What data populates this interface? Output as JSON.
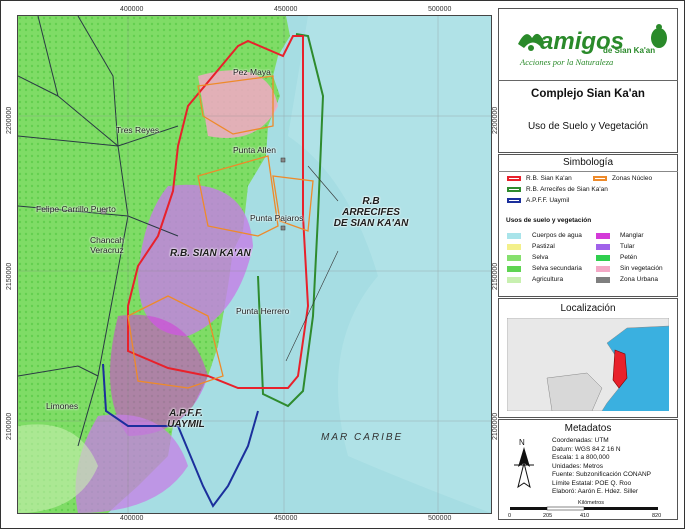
{
  "map": {
    "x_ticks": [
      "400000",
      "450000",
      "500000"
    ],
    "y_ticks": [
      "2200000",
      "2150000",
      "2100000"
    ],
    "places": {
      "pez_maya": "Pez Maya",
      "tres_reyes": "Tres Reyes",
      "punta_allen": "Punta Allen",
      "felipe_carrillo": "Felipe Carrillo Puerto",
      "punta_pajaros": "Punta Pajaros",
      "chancah": "Chancah\nVeracruz",
      "punta_herrero": "Punta Herrero",
      "limones": "Limones"
    },
    "area_labels": {
      "rb_sian_kaan": "R.B. SIAN KA'AN",
      "rb_arrecifes": "R.B\nARRECIFES\nDE SIAN KA'AN",
      "apff_uaymil": "A.P.F.F.\nUAYMIL"
    },
    "sea_label": "MAR CARIBE"
  },
  "header": {
    "brand": "amigos",
    "brand_sub": "de Sian Ka'an",
    "tagline": "Acciones por la Naturaleza"
  },
  "title": "Complejo Sian Ka'an",
  "subtitle": "Uso de Suelo y Vegetación",
  "legend": {
    "title": "Simbología",
    "boundaries": [
      {
        "label": "R.B. Sian Ka'an",
        "color": "#e8212b"
      },
      {
        "label": "Zonas Núcleo",
        "color": "#ee8a2a"
      },
      {
        "label": "R.B. Arrecifes de Sian Ka'an",
        "color": "#2e8b2e"
      },
      {
        "label": "A.P.F.F. Uaymil",
        "color": "#1b2f9c"
      }
    ],
    "landuse_title": "Usos de suelo y vegetación",
    "classes_left": [
      {
        "label": "Cuerpos de agua",
        "color": "#a9e4ea"
      },
      {
        "label": "Pastizal",
        "color": "#f3f08a"
      },
      {
        "label": "Selva",
        "color": "#86e06e"
      },
      {
        "label": "Selva secundaria",
        "color": "#5fd452"
      },
      {
        "label": "Agricultura",
        "color": "#c8f0b0"
      }
    ],
    "classes_right": [
      {
        "label": "Manglar",
        "color": "#d43ad8"
      },
      {
        "label": "Tular",
        "color": "#a062ea"
      },
      {
        "label": "Petén",
        "color": "#2fcf4e"
      },
      {
        "label": "Sin vegetación",
        "color": "#f3a8c6"
      },
      {
        "label": "Zona Urbana",
        "color": "#7f7f7f"
      }
    ]
  },
  "locator": {
    "title": "Localización"
  },
  "metadata": {
    "title": "Metadatos",
    "lines": [
      "Coordenadas: UTM",
      "Datum: WGS 84 Z 16 N",
      "Escala:  1 a 800,000",
      "Unidades: Metros",
      "Fuente: Subzonificación CONANP",
      "Límite Estatal: POE Q. Roo",
      "Elaboró: Aarón E. Hdez. Siller"
    ],
    "north": "N",
    "scale_unit": "Kilómetros",
    "scale_ticks": [
      "0",
      "205",
      "410",
      "820"
    ]
  }
}
